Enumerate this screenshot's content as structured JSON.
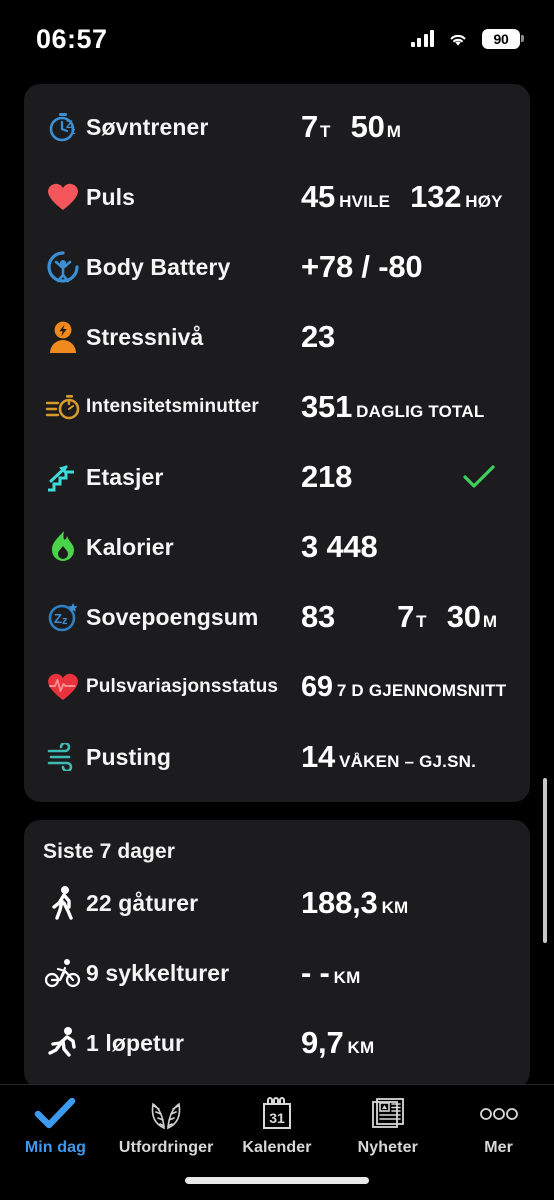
{
  "status_bar": {
    "time": "06:57",
    "battery_percent": "90",
    "signal_icon": "cellular-signal-icon",
    "wifi_icon": "wifi-icon",
    "battery_icon": "battery-icon"
  },
  "today_card": {
    "rows": [
      {
        "icon": "sleep-coach-icon",
        "label": "Søvntrener",
        "values": [
          {
            "num": "7",
            "unit": "T"
          },
          {
            "num": "50",
            "unit": "M"
          }
        ],
        "check": false
      },
      {
        "icon": "heart-icon",
        "label": "Puls",
        "values": [
          {
            "num": "45",
            "unit": "HVILE"
          },
          {
            "num": "132",
            "unit": "HØY"
          }
        ],
        "check": false
      },
      {
        "icon": "body-battery-icon",
        "label": "Body Battery",
        "values": [
          {
            "num": "+78 / -80",
            "unit": ""
          }
        ],
        "check": false
      },
      {
        "icon": "stress-person-icon",
        "label": "Stressnivå",
        "values": [
          {
            "num": "23",
            "unit": ""
          }
        ],
        "check": false
      },
      {
        "icon": "intensity-stopwatch-icon",
        "label": "Intensitetsminutter",
        "values": [
          {
            "num": "351",
            "unit": "DAGLIG TOTAL"
          }
        ],
        "check": false
      },
      {
        "icon": "stairs-icon",
        "label": "Etasjer",
        "values": [
          {
            "num": "218",
            "unit": ""
          }
        ],
        "check": true
      },
      {
        "icon": "flame-icon",
        "label": "Kalorier",
        "values": [
          {
            "num": "3 448",
            "unit": ""
          }
        ],
        "check": false
      },
      {
        "icon": "sleep-score-icon",
        "label": "Sovepoengsum",
        "values": [
          {
            "num": "83",
            "unit": ""
          },
          {
            "num": "7",
            "unit": "T"
          },
          {
            "num": "30",
            "unit": "M"
          }
        ],
        "check": false
      },
      {
        "icon": "hrv-heart-icon",
        "label": "Pulsvariasjonsstatus",
        "values": [
          {
            "num": "69",
            "unit": "7 D GJENNOMSNITT"
          }
        ],
        "check": false
      },
      {
        "icon": "breathing-icon",
        "label": "Pusting",
        "values": [
          {
            "num": "14",
            "unit": "VÅKEN – GJ.SN."
          }
        ],
        "check": false
      }
    ]
  },
  "week_card": {
    "title": "Siste 7 dager",
    "rows": [
      {
        "icon": "walking-icon",
        "label": "22 gåturer",
        "values": [
          {
            "num": "188,3",
            "unit": "KM"
          }
        ]
      },
      {
        "icon": "cycling-icon",
        "label": "9 sykkelturer",
        "values": [
          {
            "num": "- -",
            "unit": "KM"
          }
        ]
      },
      {
        "icon": "running-icon",
        "label": "1 løpetur",
        "values": [
          {
            "num": "9,7",
            "unit": "KM"
          }
        ]
      }
    ]
  },
  "tabbar": {
    "items": [
      {
        "icon": "checkmark-icon",
        "label": "Min dag",
        "active": true
      },
      {
        "icon": "laurel-wreath-icon",
        "label": "Utfordringer",
        "active": false
      },
      {
        "icon": "calendar-icon",
        "label": "Kalender",
        "active": false,
        "calendar_day": "31"
      },
      {
        "icon": "newspaper-icon",
        "label": "Nyheter",
        "active": false
      },
      {
        "icon": "more-dots-icon",
        "label": "Mer",
        "active": false
      }
    ]
  },
  "colors": {
    "accent": "#3c9bf0",
    "check_green": "#3ecf5c",
    "card_bg": "#1c1c1e",
    "page_bg": "#000000"
  }
}
